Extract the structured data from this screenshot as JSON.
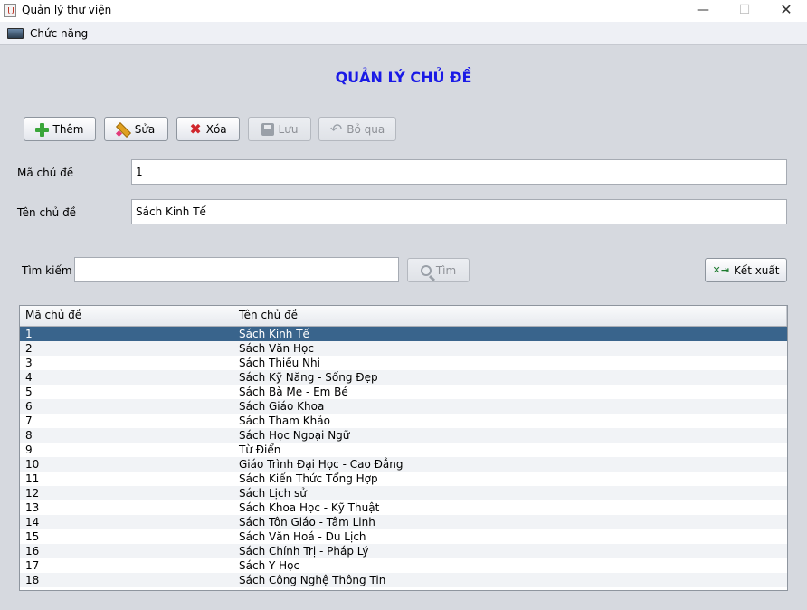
{
  "window": {
    "title": "Quản lý thư viện",
    "controls": {
      "minimize": "—",
      "maximize": "☐",
      "close": "✕"
    }
  },
  "menu": {
    "items": [
      {
        "label": "Chức năng",
        "icon": "monitor-icon"
      }
    ]
  },
  "page": {
    "heading": "QUẢN LÝ CHỦ ĐỀ"
  },
  "toolbar": {
    "add_label": "Thêm",
    "edit_label": "Sửa",
    "delete_label": "Xóa",
    "save_label": "Lưu",
    "cancel_label": "Bỏ qua"
  },
  "form": {
    "id_label": "Mã chủ đề",
    "id_value": "1",
    "name_label": "Tên chủ đề",
    "name_value": "Sách Kinh Tế"
  },
  "search": {
    "label": "Tìm kiếm",
    "value": "",
    "placeholder": "",
    "button_label": "Tìm",
    "export_label": "Kết xuất"
  },
  "table": {
    "columns": [
      "Mã chủ đề",
      "Tên chủ đề"
    ],
    "selected_row": 0,
    "rows": [
      [
        "1",
        "Sách Kinh Tế"
      ],
      [
        "2",
        "Sách Văn Học"
      ],
      [
        "3",
        "Sách Thiếu Nhi"
      ],
      [
        "4",
        "Sách Kỹ Năng - Sống Đẹp"
      ],
      [
        "5",
        "Sách Bà Mẹ - Em Bé"
      ],
      [
        "6",
        "Sách Giáo Khoa"
      ],
      [
        "7",
        "Sách Tham Khảo"
      ],
      [
        "8",
        "Sách Học Ngoại Ngữ"
      ],
      [
        "9",
        "Từ Điển"
      ],
      [
        "10",
        "Giáo Trình Đại Học - Cao Đẳng"
      ],
      [
        "11",
        "Sách Kiến Thức Tổng Hợp"
      ],
      [
        "12",
        "Sách Lịch sử"
      ],
      [
        "13",
        "Sách Khoa Học - Kỹ Thuật"
      ],
      [
        "14",
        "Sách Tôn Giáo - Tâm Linh"
      ],
      [
        "15",
        "Sách Văn Hoá - Du Lịch"
      ],
      [
        "16",
        "Sách Chính Trị - Pháp Lý"
      ],
      [
        "17",
        "Sách Y Học"
      ],
      [
        "18",
        "Sách Công Nghệ Thông Tin"
      ]
    ]
  },
  "colors": {
    "heading": "#1a1ae6",
    "selection": "#39648c",
    "background": "#d6d9df"
  }
}
